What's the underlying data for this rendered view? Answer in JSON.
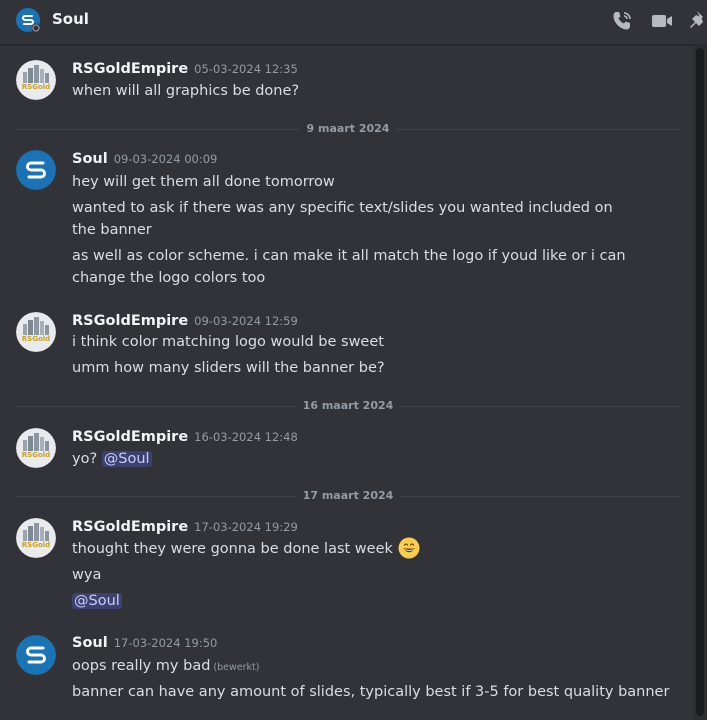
{
  "channel": {
    "name": "Soul"
  },
  "colors": {
    "accent": "#5865f2",
    "soul_avatar": "#1a73b4",
    "background": "#313338"
  },
  "header_icons": [
    "phone-call-icon",
    "video-camera-icon",
    "pin-icon"
  ],
  "dividers": [
    "9 maart 2024",
    "16 maart 2024",
    "17 maart 2024"
  ],
  "messages": [
    {
      "author": "RSGoldEmpire",
      "timestamp": "05-03-2024 12:35",
      "lines": [
        "when will all graphics be done?"
      ]
    },
    {
      "author": "Soul",
      "timestamp": "09-03-2024 00:09",
      "lines": [
        "hey will get them all done tomorrow",
        "wanted to ask if there was any specific text/slides you wanted included on the banner",
        "as well as color scheme. i can make it all match the logo if youd like or i can change the logo colors too"
      ]
    },
    {
      "author": "RSGoldEmpire",
      "timestamp": "09-03-2024 12:59",
      "lines": [
        "i think color matching logo would be sweet",
        "umm how many sliders will the banner be?"
      ]
    },
    {
      "author": "RSGoldEmpire",
      "timestamp": "16-03-2024 12:48",
      "lines": [
        "yo?"
      ],
      "mention": "@Soul"
    },
    {
      "author": "RSGoldEmpire",
      "timestamp": "17-03-2024 19:29",
      "lines": [
        "thought they were gonna be done last week",
        "wya"
      ],
      "mention": "@Soul"
    },
    {
      "author": "Soul",
      "timestamp": "17-03-2024 19:50",
      "lines": [
        "oops really my bad",
        "banner can have any amount of slides, typically best if 3-5 for best quality banner"
      ],
      "edited": "(bewerkt)"
    }
  ],
  "logo_text": "RSGold"
}
